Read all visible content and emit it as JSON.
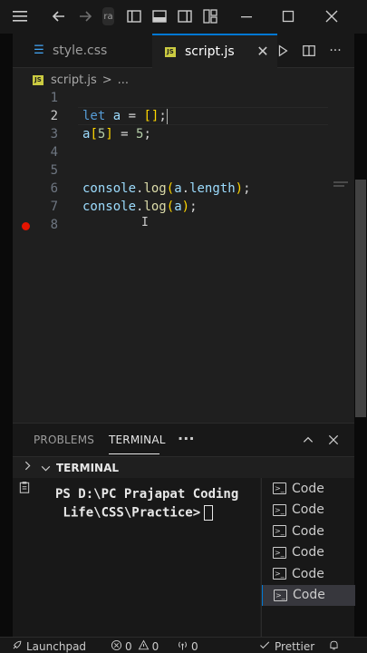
{
  "title_bar": {
    "icons": [
      "menu-icon",
      "back-arrow-icon",
      "forward-arrow-icon",
      "command-center",
      "toggle-primary-sidebar-icon",
      "toggle-panel-icon",
      "toggle-secondary-sidebar-icon",
      "customize-layout-icon",
      "minimize-icon",
      "maximize-icon",
      "close-icon"
    ],
    "command_center_text": "ra"
  },
  "tabs": [
    {
      "label": "style.css",
      "icon": "css-file-icon",
      "active": false
    },
    {
      "label": "script.js",
      "icon": "js-file-icon",
      "active": true
    }
  ],
  "tab_actions": [
    "run-icon",
    "split-editor-icon",
    "more-actions-icon"
  ],
  "breadcrumb": {
    "file": "script.js",
    "separator": ">",
    "symbol": "..."
  },
  "editor": {
    "line_numbers": [
      "1",
      "2",
      "3",
      "4",
      "5",
      "6",
      "7",
      "8"
    ],
    "current_line": 2,
    "breakpoint_line": 8,
    "lines": [
      {
        "n": "1",
        "tokens": []
      },
      {
        "n": "2",
        "tokens": [
          {
            "t": "let",
            "c": "kw"
          },
          {
            "t": " ",
            "c": "pl"
          },
          {
            "t": "a",
            "c": "var"
          },
          {
            "t": " = ",
            "c": "pl"
          },
          {
            "t": "[]",
            "c": "br"
          },
          {
            "t": ";",
            "c": "pl"
          }
        ]
      },
      {
        "n": "3",
        "tokens": [
          {
            "t": "a",
            "c": "var"
          },
          {
            "t": "[",
            "c": "br"
          },
          {
            "t": "5",
            "c": "num"
          },
          {
            "t": "]",
            "c": "br"
          },
          {
            "t": " = ",
            "c": "pl"
          },
          {
            "t": "5",
            "c": "num"
          },
          {
            "t": ";",
            "c": "pl"
          }
        ]
      },
      {
        "n": "4",
        "tokens": []
      },
      {
        "n": "5",
        "tokens": []
      },
      {
        "n": "6",
        "tokens": [
          {
            "t": "console",
            "c": "var"
          },
          {
            "t": ".",
            "c": "pl"
          },
          {
            "t": "log",
            "c": "fn"
          },
          {
            "t": "(",
            "c": "br"
          },
          {
            "t": "a",
            "c": "var"
          },
          {
            "t": ".",
            "c": "pl"
          },
          {
            "t": "length",
            "c": "var"
          },
          {
            "t": ")",
            "c": "br"
          },
          {
            "t": ";",
            "c": "pl"
          }
        ]
      },
      {
        "n": "7",
        "tokens": [
          {
            "t": "console",
            "c": "var"
          },
          {
            "t": ".",
            "c": "pl"
          },
          {
            "t": "log",
            "c": "fn"
          },
          {
            "t": "(",
            "c": "br"
          },
          {
            "t": "a",
            "c": "var"
          },
          {
            "t": ")",
            "c": "br"
          },
          {
            "t": ";",
            "c": "pl"
          }
        ]
      },
      {
        "n": "8",
        "tokens": []
      }
    ]
  },
  "panel": {
    "tabs": [
      {
        "label": "PROBLEMS",
        "active": false
      },
      {
        "label": "TERMINAL",
        "active": true
      }
    ],
    "more_label": "···",
    "section_label": "TERMINAL"
  },
  "terminal": {
    "lines": [
      "PS D:\\PC Prajapat Coding",
      " Life\\CSS\\Practice>"
    ]
  },
  "terminal_list": [
    {
      "label": "Code",
      "selected": false
    },
    {
      "label": "Code",
      "selected": false
    },
    {
      "label": "Code",
      "selected": false
    },
    {
      "label": "Code",
      "selected": false
    },
    {
      "label": "Code",
      "selected": false
    },
    {
      "label": "Code",
      "selected": true
    }
  ],
  "status_bar": {
    "launchpad": "Launchpad",
    "errors": "0",
    "warnings": "0",
    "ports": "0",
    "prettier": "Prettier"
  },
  "colors": {
    "accent": "#0078d4",
    "breakpoint": "#e51400",
    "editor_bg": "#1f1f1f",
    "chrome_bg": "#181818"
  }
}
